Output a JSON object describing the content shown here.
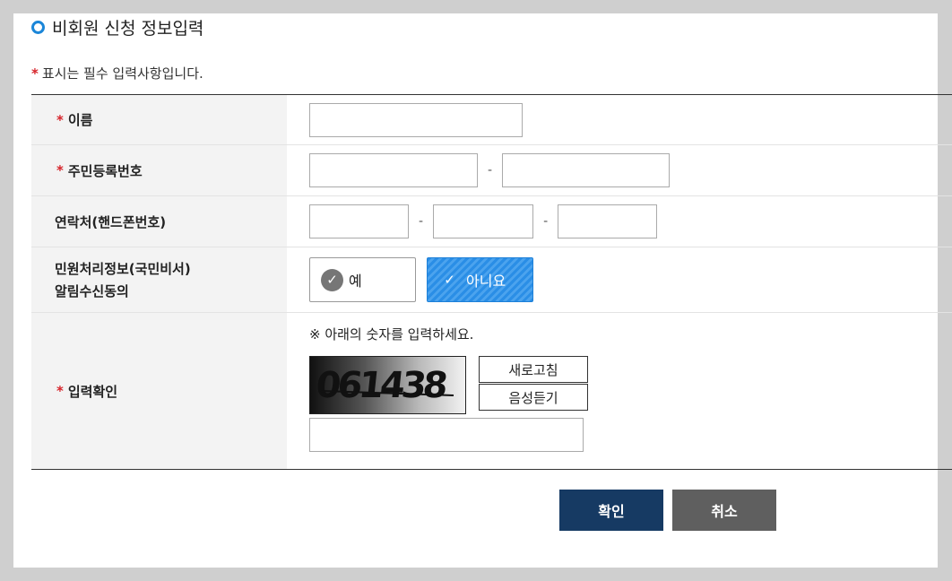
{
  "header": {
    "title": "비회원 신청 정보입력",
    "required_note": "표시는 필수 입력사항입니다.",
    "required_mark": "*"
  },
  "form": {
    "name_label": "이름",
    "ssn_label": "주민등록번호",
    "phone_label": "연락처(핸드폰번호)",
    "consent_label_line1": "민원처리정보(국민비서)",
    "consent_label_line2": "알림수신동의",
    "captcha_label": "입력확인",
    "dash": "-",
    "name_value": "",
    "ssn_front_value": "",
    "ssn_back_value": "",
    "phone1_value": "",
    "phone2_value": "",
    "phone3_value": "",
    "captcha_value": ""
  },
  "consent": {
    "yes_label": "예",
    "no_label": "아니요",
    "selected": "아니요"
  },
  "captcha": {
    "instruction": "※ 아래의 숫자를 입력하세요.",
    "image_text": "061438",
    "refresh_label": "새로고침",
    "audio_label": "음성듣기"
  },
  "actions": {
    "confirm_label": "확인",
    "cancel_label": "취소"
  },
  "colors": {
    "accent": "#1b86d8",
    "required": "#d6232a",
    "confirm_bg": "#163a63",
    "cancel_bg": "#5f5f5f",
    "selected_consent_bg": "#2a8ee6"
  }
}
